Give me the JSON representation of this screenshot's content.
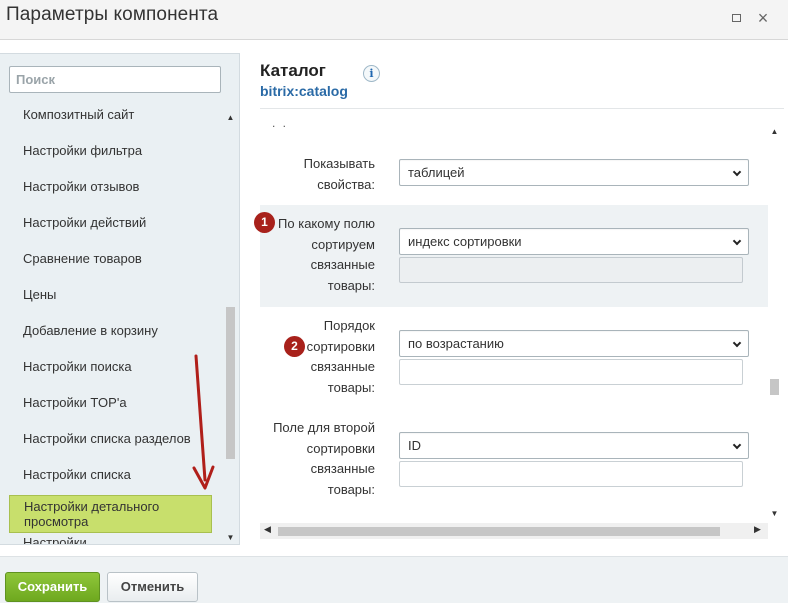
{
  "window": {
    "title": "Параметры компонента",
    "maximize_icon": "maximize-icon",
    "close_icon": "close-icon",
    "close_glyph": "×"
  },
  "sidebar": {
    "search_placeholder": "Поиск",
    "items": [
      {
        "label": "Композитный сайт"
      },
      {
        "label": "Настройки фильтра"
      },
      {
        "label": "Настройки отзывов"
      },
      {
        "label": "Настройки действий"
      },
      {
        "label": "Сравнение товаров"
      },
      {
        "label": "Цены"
      },
      {
        "label": "Добавление в корзину"
      },
      {
        "label": "Настройки поиска"
      },
      {
        "label": "Настройки TOP'а"
      },
      {
        "label": "Настройки списка разделов"
      },
      {
        "label": "Настройки списка"
      },
      {
        "label": "Настройки детального просмотра",
        "active": true
      },
      {
        "label": "Настройки..."
      }
    ],
    "active_color": "#c8df6c"
  },
  "component": {
    "name": "Каталог",
    "code": "bitrix:catalog",
    "info_icon": "info-icon",
    "info_glyph": "i",
    "ellipsis": ". ."
  },
  "fields": [
    {
      "label": "Показывать свойства:",
      "value": "таблицей"
    },
    {
      "label": "По какому полю сортируем связанные товары:",
      "value": "индекс сортировки",
      "extra_input": "",
      "badge": "1"
    },
    {
      "label": "Порядок сортировки связанные товары:",
      "value": "по возрастанию",
      "extra_input": "",
      "badge": "2"
    },
    {
      "label": "Поле для второй сортировки связанные товары:",
      "value": "ID",
      "extra_input": ""
    }
  ],
  "footer": {
    "save_label": "Сохранить",
    "cancel_label": "Отменить"
  },
  "colors": {
    "badge": "#a8211b",
    "annotation_arrow": "#b01f1a",
    "save_button": "#7ab52a",
    "link": "#2a6aa6"
  }
}
